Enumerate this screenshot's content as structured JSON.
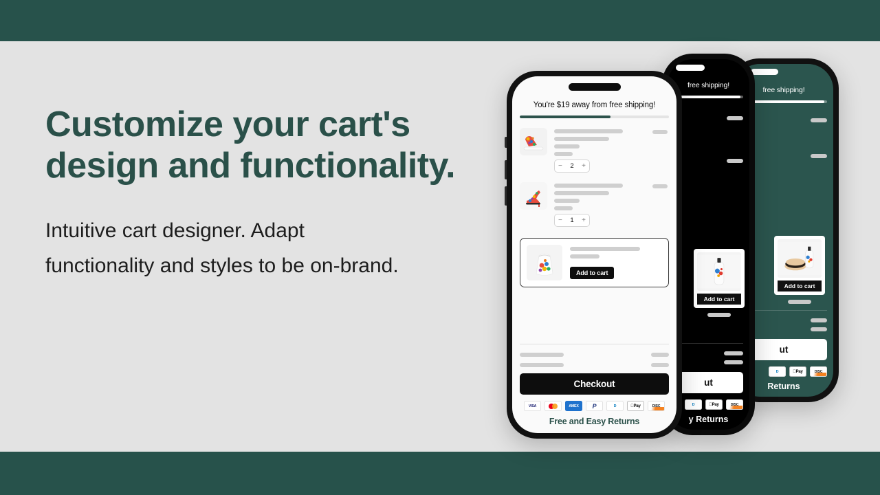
{
  "theme": {
    "band_color": "#27524b",
    "page_bg": "#e3e3e3",
    "heading_color": "#2a5049",
    "accent_dark": "#0d0d0d",
    "green_phone_bg": "#2b554e",
    "black_phone_bg": "#000000"
  },
  "copy": {
    "headline": "Customize your cart's design and functionality.",
    "body": "Intuitive cart designer. Adapt functionality and styles to be on-brand."
  },
  "cart": {
    "shipping_message": "You're $19 away from free shipping!",
    "shipping_progress_percent": 61,
    "items": [
      {
        "name": "cart-item-sneaker",
        "quantity": "2",
        "decrement": "−",
        "increment": "+"
      },
      {
        "name": "cart-item-heel",
        "quantity": "1",
        "decrement": "−",
        "increment": "+"
      }
    ],
    "upsell": {
      "add_to_cart_label": "Add to cart"
    },
    "checkout_label": "Checkout",
    "returns_label": "Free and Easy Returns",
    "payment_methods": [
      {
        "id": "visa-icon",
        "label": "VISA"
      },
      {
        "id": "mastercard-icon",
        "label": ""
      },
      {
        "id": "amex-icon",
        "label": "AMEX"
      },
      {
        "id": "paypal-icon",
        "label": "P"
      },
      {
        "id": "diners-icon",
        "label": "D"
      },
      {
        "id": "applepay-icon",
        "label": "Pay"
      },
      {
        "id": "discover-icon",
        "label": "DISC VER"
      }
    ]
  },
  "phone_black": {
    "shipping_message": "free shipping!",
    "add_to_cart_label": "Add to cart",
    "checkout_label": "ut",
    "returns_label": "y Returns",
    "payment_methods": [
      {
        "id": "diners-icon",
        "label": "D"
      },
      {
        "id": "applepay-icon",
        "label": "Pay"
      },
      {
        "id": "discover-icon",
        "label": "DISC VER"
      }
    ]
  },
  "phone_green": {
    "shipping_message": "free shipping!",
    "add_to_cart_label": "Add to cart",
    "checkout_label": "ut",
    "returns_label": "Returns",
    "payment_methods": [
      {
        "id": "diners-icon",
        "label": "D"
      },
      {
        "id": "applepay-icon",
        "label": "Pay"
      },
      {
        "id": "discover-icon",
        "label": "DISC VER"
      }
    ]
  }
}
